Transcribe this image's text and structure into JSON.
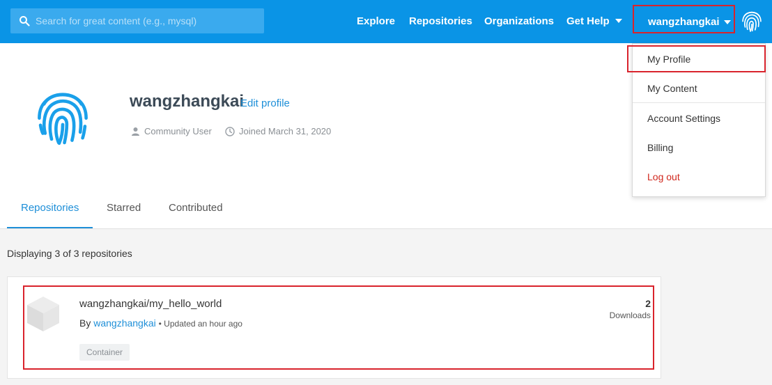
{
  "search": {
    "placeholder": "Search for great content (e.g., mysql)"
  },
  "nav": {
    "explore": "Explore",
    "repositories": "Repositories",
    "organizations": "Organizations",
    "get_help": "Get Help",
    "username": "wangzhangkai"
  },
  "user_dropdown": {
    "items": [
      "My Profile",
      "My Content",
      "Account Settings",
      "Billing",
      "Log out"
    ]
  },
  "profile": {
    "name": "wangzhangkai",
    "edit_link": "Edit profile",
    "user_type": "Community User",
    "joined": "Joined March 31, 2020"
  },
  "tabs": [
    "Repositories",
    "Starred",
    "Contributed"
  ],
  "repo_count_text": "Displaying 3 of 3 repositories",
  "repositories": [
    {
      "name": "wangzhangkai/my_hello_world",
      "by_prefix": "By",
      "owner": "wangzhangkai",
      "updated": "• Updated an hour ago",
      "badge": "Container",
      "downloads": "2",
      "downloads_label": "Downloads"
    }
  ],
  "colors": {
    "topbar": "#0a94e6",
    "link": "#1e8fd8",
    "highlight": "#d9232c",
    "logout": "#d0271d"
  },
  "icons": {
    "search": "search-icon",
    "avatar": "fingerprint-icon",
    "user": "user-icon",
    "clock": "clock-icon",
    "repo": "cube-icon",
    "caret": "caret-down-icon"
  }
}
